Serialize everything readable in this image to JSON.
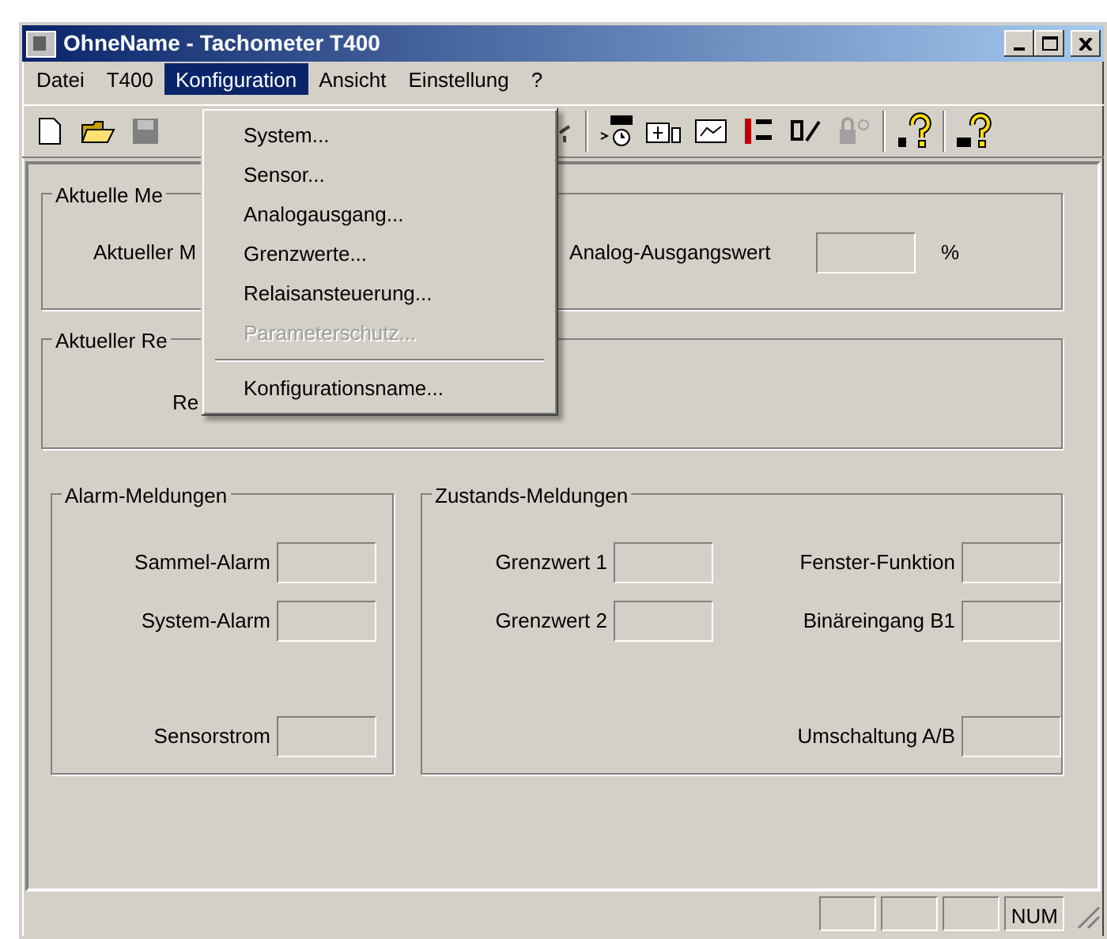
{
  "window": {
    "title": "OhneName - Tachometer T400"
  },
  "menubar": [
    {
      "label": "Datei",
      "selected": false
    },
    {
      "label": "T400",
      "selected": false
    },
    {
      "label": "Konfiguration",
      "selected": true
    },
    {
      "label": "Ansicht",
      "selected": false
    },
    {
      "label": "Einstellung",
      "selected": false
    },
    {
      "label": "?",
      "selected": false
    }
  ],
  "dropdown": [
    {
      "kind": "item",
      "label": "System...",
      "disabled": false
    },
    {
      "kind": "item",
      "label": "Sensor...",
      "disabled": false
    },
    {
      "kind": "item",
      "label": "Analogausgang...",
      "disabled": false
    },
    {
      "kind": "item",
      "label": "Grenzwerte...",
      "disabled": false
    },
    {
      "kind": "item",
      "label": "Relaisansteuerung...",
      "disabled": false
    },
    {
      "kind": "item",
      "label": "Parameterschutz...",
      "disabled": true
    },
    {
      "kind": "separator"
    },
    {
      "kind": "item",
      "label": "Konfigurationsname...",
      "disabled": false
    }
  ],
  "current_measurement": {
    "title": "Aktuelle Me",
    "label": "Aktueller M",
    "output_label": "Analog-Ausgangswert",
    "unit": "%"
  },
  "current_relay": {
    "title": "Aktueller Re",
    "label": "Re"
  },
  "alarm_messages": {
    "title": "Alarm-Meldungen",
    "fields": [
      {
        "label": "Sammel-Alarm"
      },
      {
        "label": "System-Alarm"
      },
      {
        "label": "Sensorstrom"
      }
    ]
  },
  "state_messages": {
    "title": "Zustands-Meldungen",
    "fields": [
      {
        "label": "Grenzwert 1"
      },
      {
        "label": "Fenster-Funktion"
      },
      {
        "label": "Grenzwert 2"
      },
      {
        "label": "Binäreingang B1"
      },
      {
        "label": "Umschaltung A/B"
      }
    ]
  },
  "status_bar": {
    "indicator": "NUM"
  }
}
